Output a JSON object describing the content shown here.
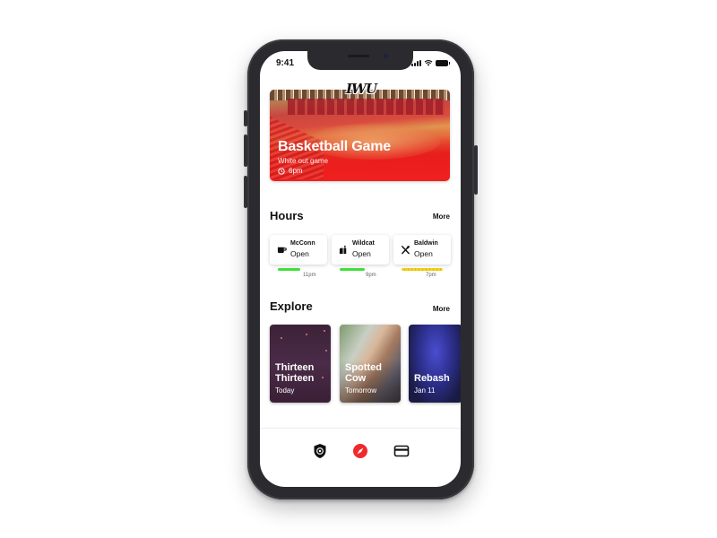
{
  "status_bar": {
    "time": "9:41",
    "icons": [
      "cellular-signal-icon",
      "wifi-icon",
      "battery-icon"
    ]
  },
  "hero": {
    "logo": "IWU",
    "title": "Basketball Game",
    "subtitle": "White out game",
    "time": "6pm",
    "time_icon": "clock-icon"
  },
  "hours": {
    "title": "Hours",
    "more_label": "More",
    "items": [
      {
        "name": "McConn",
        "status": "Open",
        "closes": "11pm",
        "icon": "coffee-cup-icon",
        "progress": 0.55,
        "bar_color": "#3ee03a"
      },
      {
        "name": "Wildcat",
        "status": "Open",
        "closes": "9pm",
        "icon": "food-tray-icon",
        "progress": 0.6,
        "bar_color": "#3ee03a"
      },
      {
        "name": "Baldwin",
        "status": "Open",
        "closes": "7pm",
        "icon": "fork-knife-icon",
        "progress": 1.0,
        "bar_color": "#f2d21c"
      }
    ]
  },
  "explore": {
    "title": "Explore",
    "more_label": "More",
    "items": [
      {
        "title": "Thirteen Thirteen",
        "date": "Today"
      },
      {
        "title": "Spotted Cow",
        "date": "Tomorrow"
      },
      {
        "title": "Rebash",
        "date": "Jan 11"
      }
    ]
  },
  "tab_bar": {
    "items": [
      {
        "name": "safety",
        "icon": "shield-target-icon",
        "active": false
      },
      {
        "name": "explore",
        "icon": "compass-icon",
        "active": true
      },
      {
        "name": "card",
        "icon": "credit-card-icon",
        "active": false
      }
    ],
    "accent_color": "#f02a2a"
  }
}
